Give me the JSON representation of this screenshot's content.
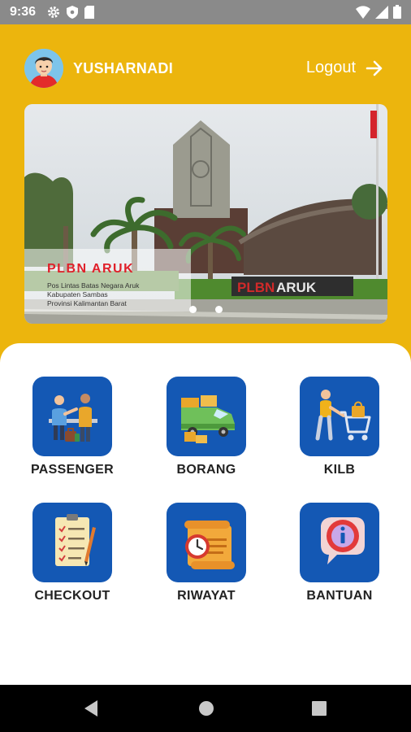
{
  "status_bar": {
    "time": "9:36"
  },
  "header": {
    "username": "YUSHARNADI",
    "logout_label": "Logout"
  },
  "banner": {
    "title": "PLBN ARUK",
    "lines": [
      "Pos Lintas Batas Negara Aruk",
      "Kabupaten Sambas",
      "Provinsi Kalimantan Barat"
    ],
    "sign_text_red": "PLBN",
    "sign_text_white": "ARUK",
    "slide_count": 2,
    "active_slide": 1
  },
  "menu": {
    "items": [
      {
        "label": "PASSENGER",
        "icon": "passenger-icon"
      },
      {
        "label": "BORANG",
        "icon": "truck-icon"
      },
      {
        "label": "KILB",
        "icon": "shopping-cart-icon"
      },
      {
        "label": "CHECKOUT",
        "icon": "checklist-icon"
      },
      {
        "label": "RIWAYAT",
        "icon": "history-scroll-icon"
      },
      {
        "label": "BANTUAN",
        "icon": "help-info-icon"
      }
    ]
  },
  "colors": {
    "header": "#ecb50d",
    "tile": "#1458b4",
    "accent_red": "#e0202a"
  }
}
